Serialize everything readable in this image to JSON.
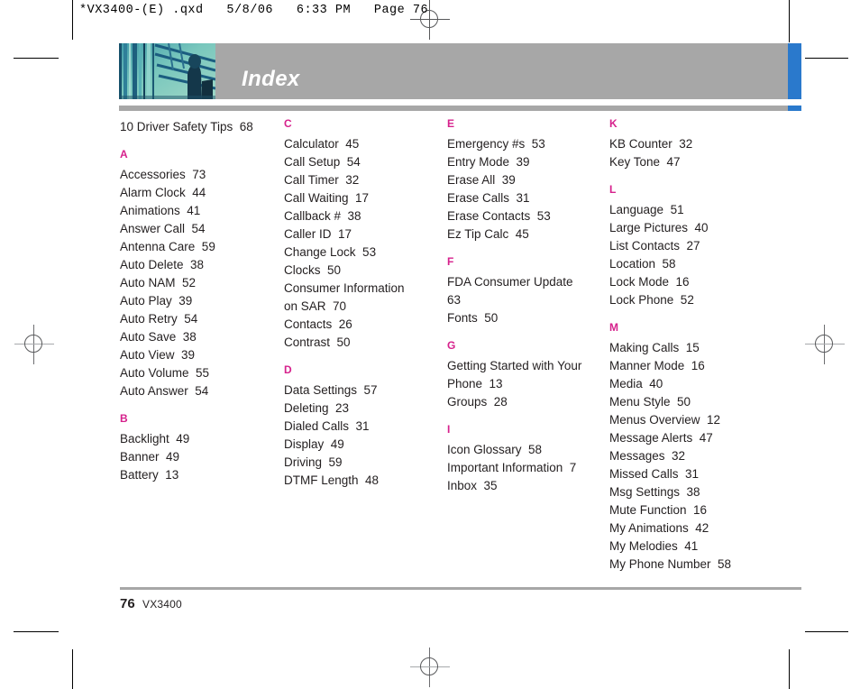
{
  "print_header": {
    "text": "*VX3400-(E) .qxd   5/8/06   6:33 PM   Page 76"
  },
  "header": {
    "title": "Index",
    "accent_color": "#2a79cc",
    "band_color": "#a7a7a7",
    "photo_alt": "abstract-blue-architecture-photo"
  },
  "colors": {
    "section_letter": "#d6218c",
    "text": "#231f20",
    "rule": "#a7a7a7"
  },
  "columns": [
    {
      "lead": "10 Driver Safety Tips  68",
      "sections": [
        {
          "letter": "A",
          "entries": [
            "Accessories  73",
            "Alarm Clock  44",
            "Animations  41",
            "Answer Call  54",
            "Antenna Care  59",
            "Auto Delete  38",
            "Auto NAM  52",
            "Auto Play  39",
            "Auto Retry  54",
            "Auto Save  38",
            "Auto View  39",
            "Auto Volume  55",
            "Auto Answer  54"
          ]
        },
        {
          "letter": "B",
          "entries": [
            "Backlight  49",
            "Banner  49",
            "Battery  13"
          ]
        }
      ]
    },
    {
      "lead": "",
      "sections": [
        {
          "letter": "C",
          "entries": [
            "Calculator  45",
            "Call Setup  54",
            "Call Timer  32",
            "Call Waiting  17",
            "Callback #  38",
            "Caller ID  17",
            "Change Lock  53",
            "Clocks  50",
            "Consumer Information\non SAR  70",
            "Contacts  26",
            "Contrast  50"
          ]
        },
        {
          "letter": "D",
          "entries": [
            "Data Settings  57",
            "Deleting  23",
            "Dialed Calls  31",
            "Display  49",
            "Driving  59",
            "DTMF Length  48"
          ]
        }
      ]
    },
    {
      "lead": "",
      "sections": [
        {
          "letter": "E",
          "entries": [
            "Emergency #s  53",
            "Entry Mode  39",
            "Erase All  39",
            "Erase Calls  31",
            "Erase Contacts  53",
            "Ez Tip Calc  45"
          ]
        },
        {
          "letter": "F",
          "entries": [
            "FDA Consumer Update\n63",
            "Fonts  50"
          ]
        },
        {
          "letter": "G",
          "entries": [
            "Getting Started with Your\nPhone  13",
            "Groups  28"
          ]
        },
        {
          "letter": "I",
          "entries": [
            "Icon Glossary  58",
            "Important Information  7",
            "Inbox  35"
          ]
        }
      ]
    },
    {
      "lead": "",
      "sections": [
        {
          "letter": "K",
          "entries": [
            "KB Counter  32",
            "Key Tone  47"
          ]
        },
        {
          "letter": "L",
          "entries": [
            "Language  51",
            "Large Pictures  40",
            "List Contacts  27",
            "Location  58",
            "Lock Mode  16",
            "Lock Phone  52"
          ]
        },
        {
          "letter": "M",
          "entries": [
            "Making Calls  15",
            "Manner Mode  16",
            "Media  40",
            "Menu Style  50",
            "Menus Overview  12",
            "Message Alerts  47",
            "Messages  32",
            "Missed Calls  31",
            "Msg Settings  38",
            "Mute Function  16",
            "My Animations  42",
            "My Melodies  41",
            "My Phone Number  58"
          ]
        }
      ]
    }
  ],
  "footer": {
    "page_number": "76",
    "model": "VX3400"
  }
}
